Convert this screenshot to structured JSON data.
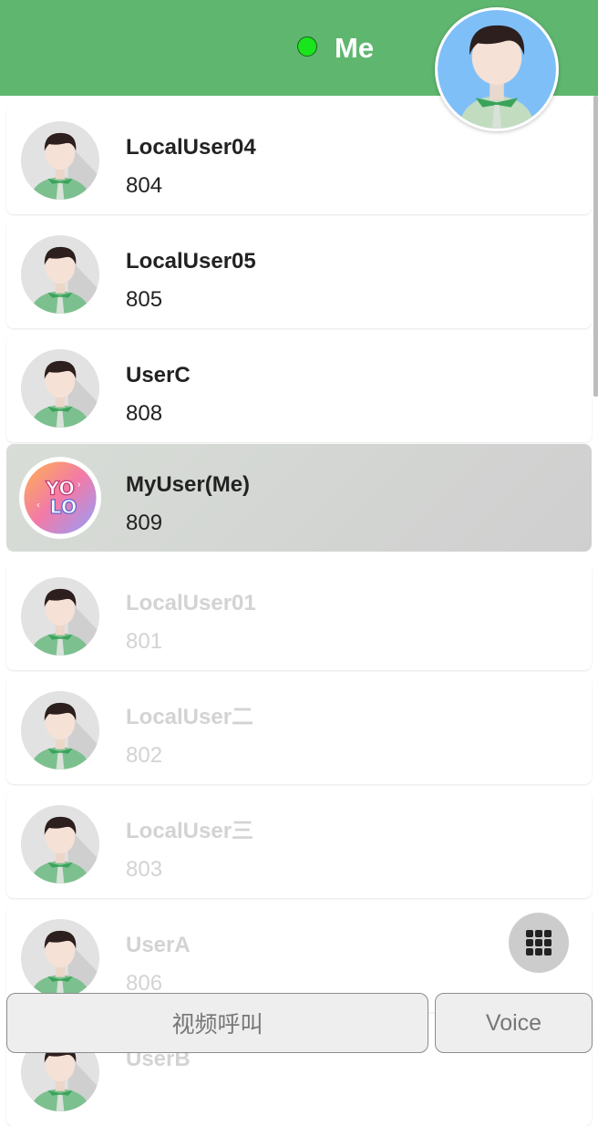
{
  "header": {
    "title": "Me",
    "status_color": "#19e51c",
    "background": "#5fb76f"
  },
  "contacts": [
    {
      "name": "LocalUser04",
      "number": "804",
      "status": "online"
    },
    {
      "name": "LocalUser05",
      "number": "805",
      "status": "online"
    },
    {
      "name": "UserC",
      "number": "808",
      "status": "online"
    },
    {
      "name": "MyUser(Me)",
      "number": "809",
      "status": "self",
      "avatar": "yolo-avatar"
    },
    {
      "name": "LocalUser01",
      "number": "801",
      "status": "offline"
    },
    {
      "name": "LocalUser二",
      "number": "802",
      "status": "offline"
    },
    {
      "name": "LocalUser三",
      "number": "803",
      "status": "offline"
    },
    {
      "name": "UserA",
      "number": "806",
      "status": "offline"
    },
    {
      "name": "UserB",
      "number": "",
      "status": "offline"
    }
  ],
  "actions": {
    "video_call_label": "视频呼叫",
    "voice_label": "Voice"
  },
  "icons": {
    "dialpad": "dialpad-icon",
    "default_avatar": "person-avatar-icon"
  }
}
